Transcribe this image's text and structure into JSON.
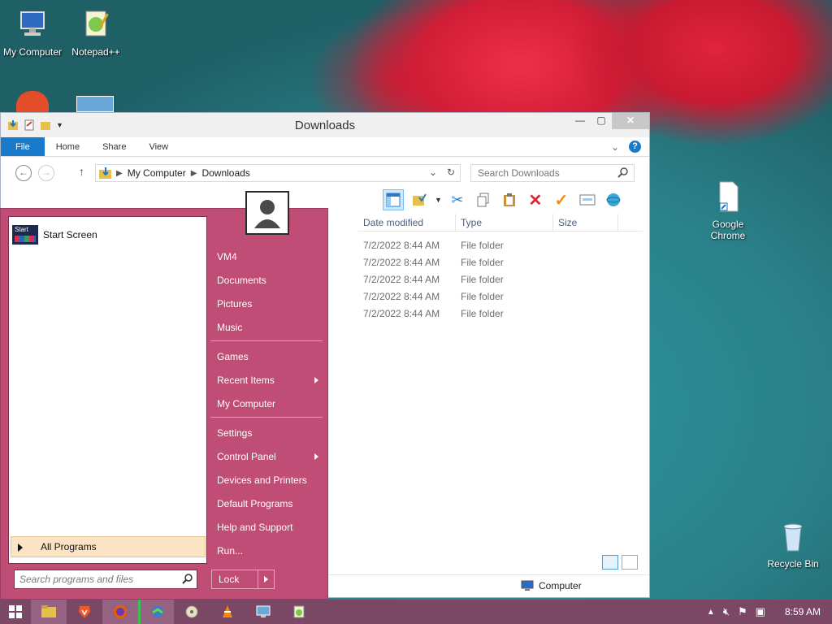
{
  "desktop": {
    "icons": [
      {
        "label": "My Computer"
      },
      {
        "label": "Notepad++"
      },
      {
        "label": "Google Chrome"
      },
      {
        "label": "Recycle Bin"
      }
    ]
  },
  "explorer": {
    "title": "Downloads",
    "ribbon_tabs": [
      "File",
      "Home",
      "Share",
      "View"
    ],
    "address": {
      "crumbs": [
        "My Computer",
        "Downloads"
      ]
    },
    "search_placeholder": "Search Downloads",
    "columns": [
      "Date modified",
      "Type",
      "Size"
    ],
    "rows": [
      {
        "date": "7/2/2022 8:44 AM",
        "type": "File folder"
      },
      {
        "date": "7/2/2022 8:44 AM",
        "type": "File folder"
      },
      {
        "date": "7/2/2022 8:44 AM",
        "type": "File folder"
      },
      {
        "date": "7/2/2022 8:44 AM",
        "type": "File folder"
      },
      {
        "date": "7/2/2022 8:44 AM",
        "type": "File folder"
      }
    ],
    "status_location": "Computer"
  },
  "start_menu": {
    "pinned": [
      {
        "label": "Start Screen",
        "tile_text": "Start"
      }
    ],
    "all_programs": "All Programs",
    "search_placeholder": "Search programs and files",
    "right_items": [
      "VM4",
      "Documents",
      "Pictures",
      "Music",
      "Games",
      "Recent Items",
      "My Computer",
      "Settings",
      "Control Panel",
      "Devices and Printers",
      "Default Programs",
      "Help and Support",
      "Run..."
    ],
    "lock_label": "Lock"
  },
  "taskbar": {
    "clock": "8:59 AM"
  },
  "colors": {
    "start_menu_bg": "#c04d75",
    "file_tab": "#1979ca",
    "taskbar": "#7a4864"
  }
}
